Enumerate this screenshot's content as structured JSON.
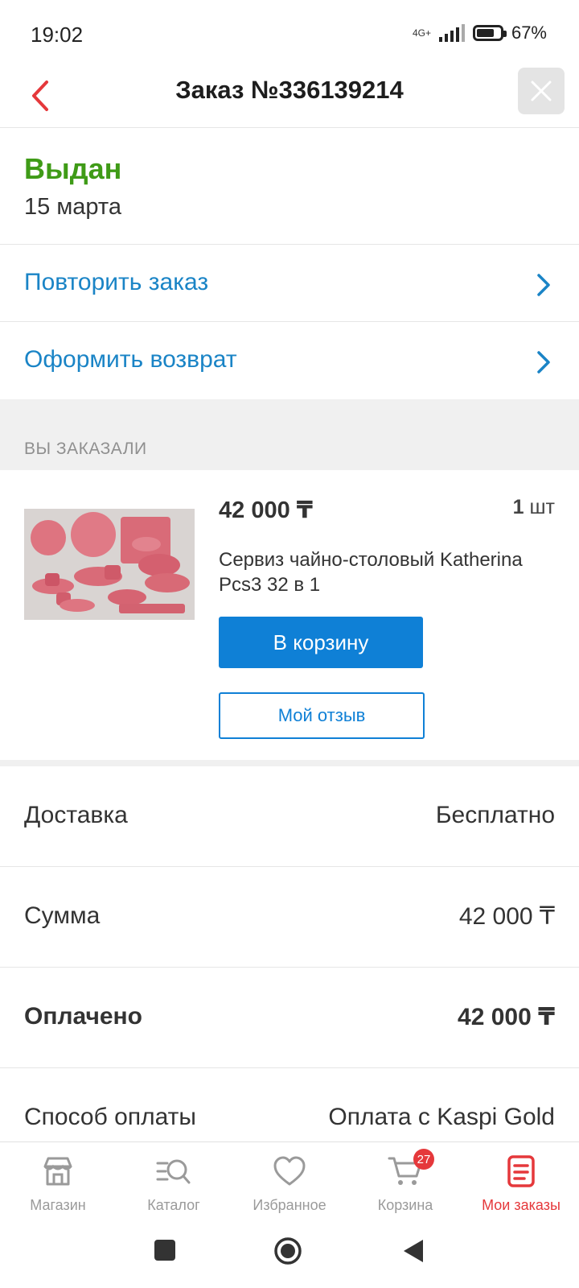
{
  "status_bar": {
    "time": "19:02",
    "network": "4G+",
    "battery": "67%"
  },
  "header": {
    "title": "Заказ №336139214"
  },
  "order_status": {
    "status": "Выдан",
    "date": "15 марта",
    "status_color": "#3f9b17"
  },
  "actions": {
    "repeat": "Повторить заказ",
    "return": "Оформить возврат"
  },
  "ordered_section": {
    "title": "ВЫ ЗАКАЗАЛИ"
  },
  "product": {
    "price": "42 000 ₸",
    "quantity": "1",
    "quantity_unit": "шт",
    "name": "Сервиз чайно-столовый Katherina Pcs3 32 в 1",
    "cart_button": "В корзину",
    "review_button": "Мой отзыв"
  },
  "summary": [
    {
      "label": "Доставка",
      "value": "Бесплатно"
    },
    {
      "label": "Сумма",
      "value": "42 000 ₸"
    },
    {
      "label": "Оплачено",
      "value": "42 000 ₸"
    },
    {
      "label": "Способ оплаты",
      "value": "Оплата с Kaspi Gold"
    }
  ],
  "bottom_nav": [
    {
      "label": "Магазин",
      "icon": "store-icon"
    },
    {
      "label": "Каталог",
      "icon": "catalog-search-icon"
    },
    {
      "label": "Избранное",
      "icon": "heart-icon"
    },
    {
      "label": "Корзина",
      "icon": "cart-icon",
      "badge": "27"
    },
    {
      "label": "Мои заказы",
      "icon": "orders-icon",
      "active": true
    }
  ],
  "colors": {
    "accent_blue": "#0f80d6",
    "link_blue": "#1a84c6",
    "brand_red": "#e5383b"
  }
}
